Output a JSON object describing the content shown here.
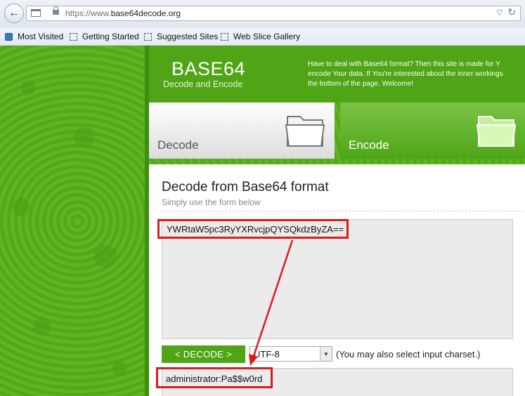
{
  "browser": {
    "url_scheme": "https://www.",
    "url_domain": "base64decode.org",
    "bookmarks": [
      "Most Visited",
      "Getting Started",
      "Suggested Sites",
      "Web Slice Gallery"
    ]
  },
  "site": {
    "logo_title": "BASE64",
    "logo_subtitle": "Decode and Encode",
    "intro_lines": [
      "Have to deal with Base64 format? Then this site is made for Y",
      "encode Your data. If You're interested about the inner workings",
      "the bottom of the page. Welcome!"
    ],
    "tabs": {
      "decode": "Decode",
      "encode": "Encode"
    }
  },
  "form": {
    "title": "Decode from Base64 format",
    "subtitle": "Simply use the form below",
    "input_value": "YWRtaW5pc3RyYXRvcjpQYSQkdzByZA==",
    "decode_button": "< DECODE >",
    "charset_value": "UTF-8",
    "charset_note": "(You may also select input charset.)",
    "output_value": "administrator:Pa$$w0rd"
  },
  "colors": {
    "brand_green": "#4fa516",
    "annotation_red": "#dd1b1b"
  }
}
